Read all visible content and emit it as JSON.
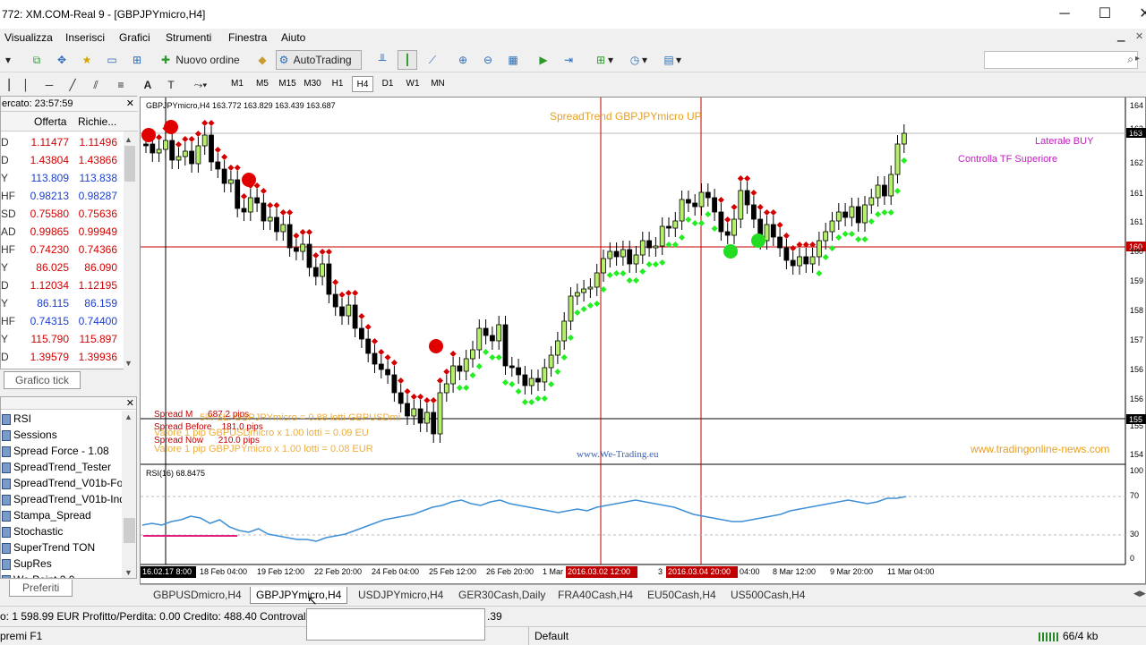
{
  "window": {
    "title": "772: XM.COM-Real 9 - [GBPJPYmicro,H4]",
    "minimize": "─",
    "maximize": "☐",
    "close": "✕"
  },
  "menu": [
    "Visualizza",
    "Inserisci",
    "Grafici",
    "Strumenti",
    "Finestra",
    "Aiuto"
  ],
  "toolbar": {
    "new_order": "Nuovo ordine",
    "autotrading": "AutoTrading"
  },
  "timeframes": [
    "M1",
    "M5",
    "M15",
    "M30",
    "H1",
    "H4",
    "D1",
    "W1",
    "MN"
  ],
  "timeframe_active": "H4",
  "market_watch": {
    "header": "ercato: 23:57:59",
    "col_bid": "Offerta",
    "col_ask": "Richie...",
    "rows": [
      {
        "sym": "D",
        "bid": "1.11477",
        "ask": "1.11496",
        "dir": "down"
      },
      {
        "sym": "D",
        "bid": "1.43804",
        "ask": "1.43866",
        "dir": "down"
      },
      {
        "sym": "Y",
        "bid": "113.809",
        "ask": "113.838",
        "dir": "up"
      },
      {
        "sym": "HF",
        "bid": "0.98213",
        "ask": "0.98287",
        "dir": "up"
      },
      {
        "sym": "SD",
        "bid": "0.75580",
        "ask": "0.75636",
        "dir": "down"
      },
      {
        "sym": "AD",
        "bid": "0.99865",
        "ask": "0.99949",
        "dir": "down"
      },
      {
        "sym": "HF",
        "bid": "0.74230",
        "ask": "0.74366",
        "dir": "down"
      },
      {
        "sym": "Y",
        "bid": "86.025",
        "ask": "86.090",
        "dir": "down"
      },
      {
        "sym": "D",
        "bid": "1.12034",
        "ask": "1.12195",
        "dir": "down"
      },
      {
        "sym": "Y",
        "bid": "86.115",
        "ask": "86.159",
        "dir": "up"
      },
      {
        "sym": "HF",
        "bid": "0.74315",
        "ask": "0.74400",
        "dir": "up"
      },
      {
        "sym": "Y",
        "bid": "115.790",
        "ask": "115.897",
        "dir": "down"
      },
      {
        "sym": "D",
        "bid": "1.39579",
        "ask": "1.39936",
        "dir": "down"
      }
    ],
    "tab": "Grafico tick"
  },
  "navigator": {
    "items": [
      "RSI",
      "Sessions",
      "Spread Force - 1.08",
      "SpreadTrend_Tester",
      "SpreadTrend_V01b-For",
      "SpreadTrend_V01b-Ind",
      "Stampa_Spread",
      "Stochastic",
      "SuperTrend TON",
      "SupRes",
      "We Point 2.0"
    ],
    "tab": "Preferiti"
  },
  "chart": {
    "header": "GBPJPYmicro,H4  163.772 163.829 163.439 163.687",
    "spreadtrend_label": "SpreadTrend  GBPJPYmicro  UP",
    "laterale": "Laterale BUY",
    "controlla": "Controlla TF Superiore",
    "spread_m": "Spread M      687.2 pips",
    "spread_before": "Spread Before    181.0 pips",
    "spread_now": "Spread Now      210.0 pips",
    "overlay1": "5% SL: GBPJPYmicro = 0.88 lotti GBPUSDmi",
    "overlay2": "Valore 1 pip GBPUSDmicro x 1.00 lotti = 0.09 EU",
    "overlay3": "Valore 1 pip GBPJPYmicro x 1.00 lotti = 0.08 EUR",
    "watermark1": "www.We-Trading.eu",
    "watermark2": "www.tradingonline-news.com",
    "rsi_label": "RSI(16) 68.8475",
    "price_axis": [
      "164",
      "163",
      "162",
      "161",
      "161",
      "160",
      "159",
      "158",
      "157",
      "156",
      "156",
      "155",
      "154"
    ],
    "price_tag_current": "163",
    "price_tag_red": "160",
    "price_tag_black": "155",
    "rsi_axis": [
      "100",
      "70",
      "30",
      "0"
    ],
    "time_axis": [
      "16.02.17 8:00",
      "18 Feb 04:00",
      "19 Feb 12:00",
      "22 Feb 20:00",
      "24 Feb 04:00",
      "25 Feb 12:00",
      "26 Feb 20:00",
      "1 Mar",
      "2016.03.02 12:00",
      "3",
      "2016.03.04 20:00",
      "04:00",
      "8 Mar 12:00",
      "9 Mar 20:00",
      "11 Mar 04:00"
    ]
  },
  "chart_tabs": [
    "GBPUSDmicro,H4",
    "GBPJPYmicro,H4",
    "USDJPYmicro,H4",
    "GER30Cash,Daily",
    "FRA40Cash,H4",
    "EU50Cash,H4",
    "US500Cash,H4"
  ],
  "chart_tab_active": 1,
  "status": {
    "balance": "o: 1 598.99 EUR  Profitto/Perdita: 0.00  Credito: 488.40  Controvalor",
    "trail": ".39",
    "help": "premi F1",
    "profile": "Default",
    "traffic": "66/4 kb"
  }
}
